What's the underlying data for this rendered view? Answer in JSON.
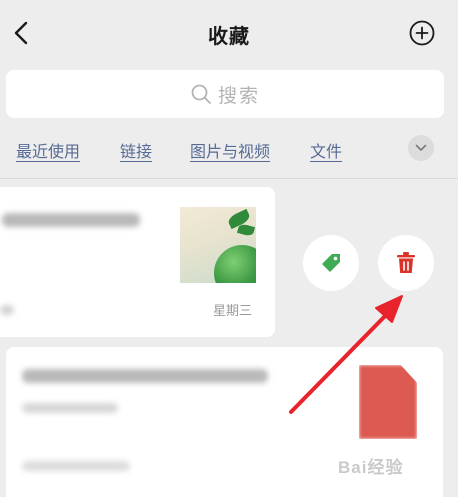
{
  "header": {
    "title": "收藏",
    "back_icon": "chevron-left-icon",
    "add_icon": "plus-circle-icon"
  },
  "search": {
    "placeholder": "搜索",
    "icon": "search-icon"
  },
  "filters": {
    "items": [
      "最近使用",
      "链接",
      "图片与视频",
      "文件"
    ],
    "expand_icon": "chevron-down-icon",
    "link_color": "#576b95"
  },
  "favorites": [
    {
      "kind": "image-note",
      "date": "星期三"
    },
    {
      "kind": "pdf-file",
      "file_icon": "pdf-file-icon",
      "file_icon_color": "#dd5a52"
    }
  ],
  "swipe_actions": {
    "tag": {
      "icon": "tag-icon",
      "color": "#3fab55"
    },
    "delete": {
      "icon": "trash-icon",
      "color": "#d9342b"
    }
  },
  "annotation": {
    "arrow_color": "#e8232b"
  },
  "watermark": {
    "text": "Bai经验"
  }
}
